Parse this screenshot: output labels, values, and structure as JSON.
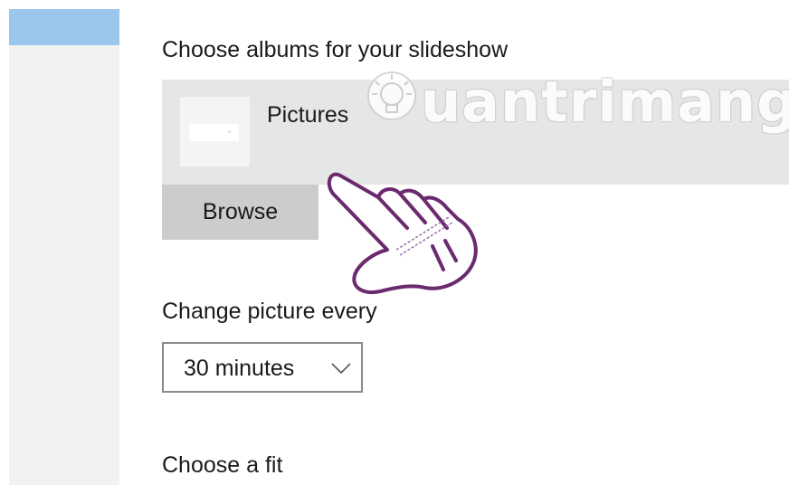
{
  "albums": {
    "title": "Choose albums for your slideshow",
    "items": [
      {
        "label": "Pictures"
      }
    ],
    "browse_label": "Browse"
  },
  "interval": {
    "title": "Change picture every",
    "selected": "30 minutes"
  },
  "fit": {
    "title": "Choose a fit"
  },
  "watermark": {
    "text": "uantrimang"
  },
  "colors": {
    "nav_accent": "#9cc7ec",
    "tile_bg": "#e6e6e6",
    "button_bg": "#cccccc",
    "hand_stroke": "#6b2a6e"
  },
  "icons": [
    "chevron-down-icon",
    "hand-pointer-icon",
    "lightbulb-icon"
  ]
}
